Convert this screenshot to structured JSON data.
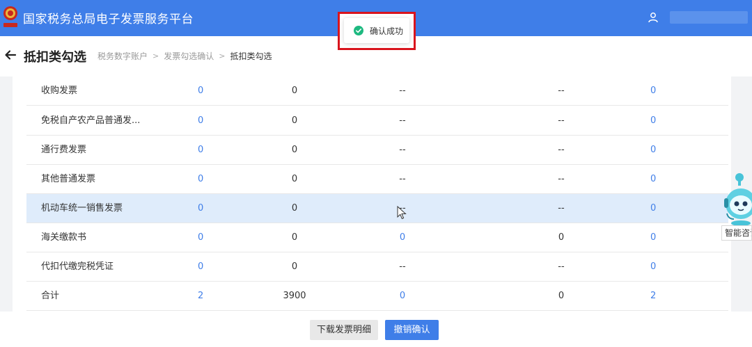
{
  "app": {
    "title": "国家税务总局电子发票服务平台"
  },
  "header": {
    "page_title": "抵扣类勾选",
    "breadcrumb": [
      "税务数字账户",
      "发票勾选确认",
      "抵扣类勾选"
    ]
  },
  "toast": {
    "text": "确认成功"
  },
  "table": {
    "rows": [
      {
        "name": "收购发票",
        "c1": "0",
        "c2": "0",
        "c3": "--",
        "c4": "--",
        "c5": "0"
      },
      {
        "name": "免税自产农产品普通发...",
        "c1": "0",
        "c2": "0",
        "c3": "--",
        "c4": "--",
        "c5": "0"
      },
      {
        "name": "通行费发票",
        "c1": "0",
        "c2": "0",
        "c3": "--",
        "c4": "--",
        "c5": "0"
      },
      {
        "name": "其他普通发票",
        "c1": "0",
        "c2": "0",
        "c3": "--",
        "c4": "--",
        "c5": "0"
      },
      {
        "name": "机动车统一销售发票",
        "c1": "0",
        "c2": "0",
        "c3": "--",
        "c4": "--",
        "c5": "0"
      },
      {
        "name": "海关缴款书",
        "c1": "0",
        "c2": "0",
        "c3": "0",
        "c4": "0",
        "c5": "0"
      },
      {
        "name": "代扣代缴完税凭证",
        "c1": "0",
        "c2": "0",
        "c3": "--",
        "c4": "--",
        "c5": "0"
      },
      {
        "name": "合计",
        "c1": "2",
        "c2": "3900",
        "c3": "0",
        "c4": "0",
        "c5": "2"
      }
    ]
  },
  "footer": {
    "download_label": "下载发票明细",
    "cancel_label": "撤销确认"
  },
  "assistant": {
    "label": "智能咨询"
  },
  "colors": {
    "brand": "#3f7ee8",
    "highlight_row": "#dfecfb",
    "annotation_red": "#d9141d",
    "success": "#1eb980"
  }
}
